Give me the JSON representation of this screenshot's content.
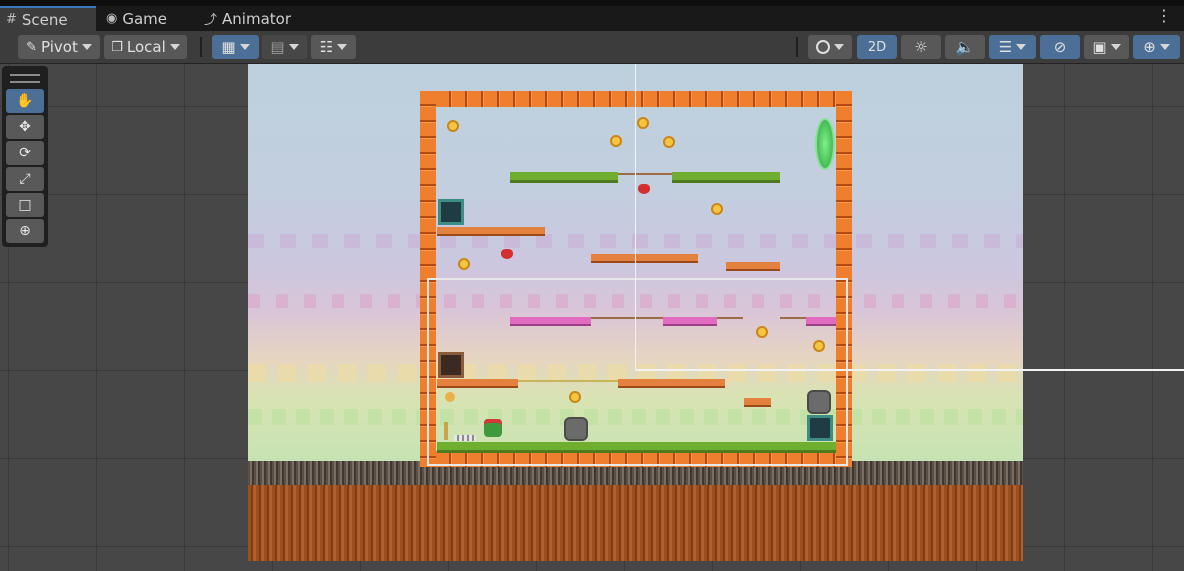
{
  "tabs": [
    {
      "label": "Scene",
      "icon": "grid-icon"
    },
    {
      "label": "Game",
      "icon": "gamepad-icon"
    },
    {
      "label": "Animator",
      "icon": "animator-icon"
    }
  ],
  "toolbar": {
    "pivot_label": "Pivot",
    "local_label": "Local",
    "mode_2d_label": "2D"
  },
  "tools": [
    {
      "name": "hand-tool",
      "icon": "hand-icon"
    },
    {
      "name": "move-tool",
      "icon": "move-icon"
    },
    {
      "name": "rotate-tool",
      "icon": "rotate-icon"
    },
    {
      "name": "scale-tool",
      "icon": "scale-icon"
    },
    {
      "name": "rect-tool",
      "icon": "rect-icon"
    },
    {
      "name": "transform-tool",
      "icon": "transform-icon"
    }
  ],
  "colors": {
    "accent": "#4b6f96",
    "brick": "#ef7f2d",
    "grass": "#6fae2e",
    "coin": "#f5c542"
  }
}
